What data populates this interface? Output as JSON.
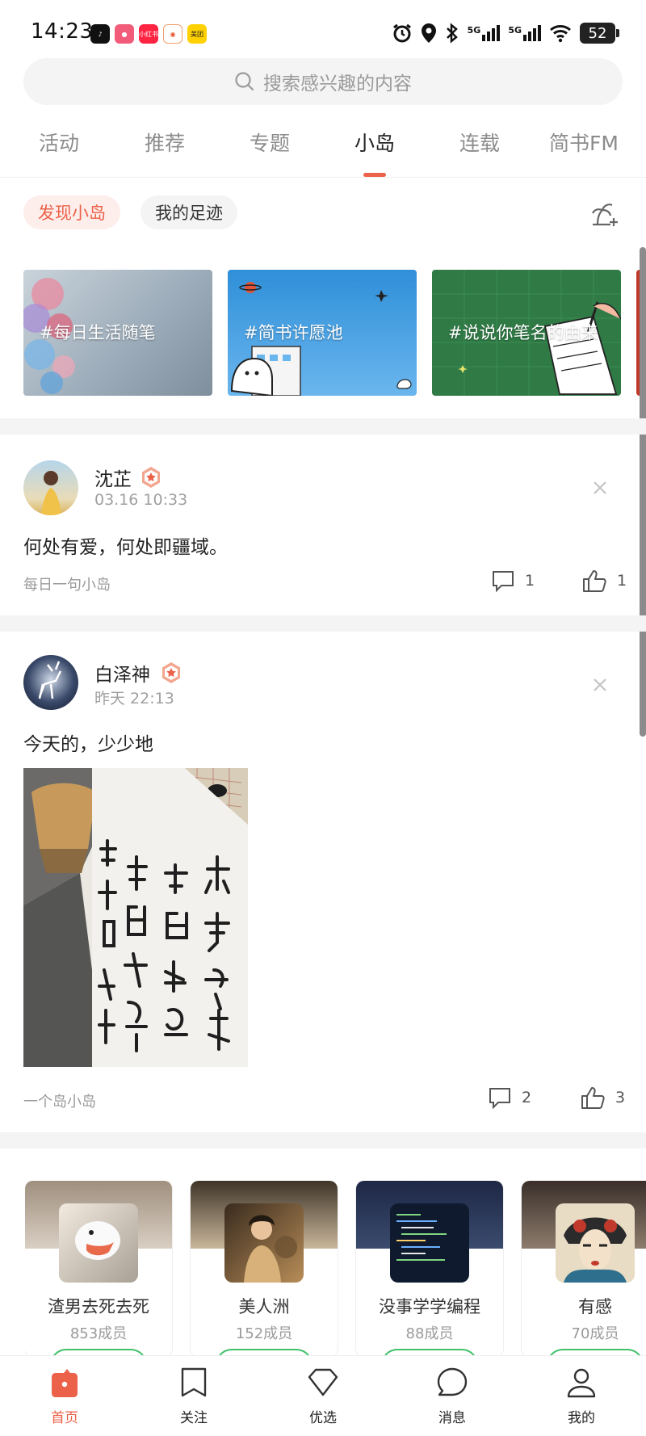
{
  "status_bar": {
    "time": "14:23",
    "apps": [
      "tiktok-icon",
      "red-app-icon",
      "xiaohongshu-icon",
      "orange-app-icon",
      "meituan-icon"
    ],
    "xiaohongshu_label": "小红书",
    "meituan_label": "美团",
    "network_a": "5G",
    "network_b": "5G",
    "battery": "52"
  },
  "search": {
    "placeholder": "搜索感兴趣的内容"
  },
  "tabs": [
    {
      "label": "活动"
    },
    {
      "label": "推荐"
    },
    {
      "label": "专题"
    },
    {
      "label": "小岛",
      "active": true
    },
    {
      "label": "连载"
    },
    {
      "label": "简书FM"
    }
  ],
  "subtabs": [
    {
      "label": "发现小岛",
      "active": true
    },
    {
      "label": "我的足迹"
    }
  ],
  "topics": [
    {
      "label": "#每日生活随笔"
    },
    {
      "label": "#简书许愿池"
    },
    {
      "label": "#说说你笔名的由来"
    }
  ],
  "posts": [
    {
      "author": "沈芷",
      "time": "03.16 10:33",
      "text": "何处有爱，何处即疆域。",
      "island": "每日一句小岛",
      "comments": "1",
      "likes": "1"
    },
    {
      "author": "白泽神",
      "time": "昨天 22:13",
      "text": "今天的，少少地",
      "island": "一个岛小岛",
      "comments": "2",
      "likes": "3"
    }
  ],
  "islands": [
    {
      "name": "渣男去死去死",
      "members": "853成员"
    },
    {
      "name": "美人洲",
      "members": "152成员"
    },
    {
      "name": "没事学学编程",
      "members": "88成员"
    },
    {
      "name": "有感",
      "members": "70成员"
    }
  ],
  "bottom_nav": [
    {
      "label": "首页",
      "icon": "home-icon",
      "active": true
    },
    {
      "label": "关注",
      "icon": "bookmark-icon"
    },
    {
      "label": "优选",
      "icon": "diamond-icon"
    },
    {
      "label": "消息",
      "icon": "message-icon"
    },
    {
      "label": "我的",
      "icon": "profile-icon"
    }
  ],
  "colors": {
    "accent": "#ec6149",
    "accent_light": "#fdeeeb",
    "green": "#42c06c",
    "text": "#222222",
    "muted": "#9a9a9a"
  }
}
